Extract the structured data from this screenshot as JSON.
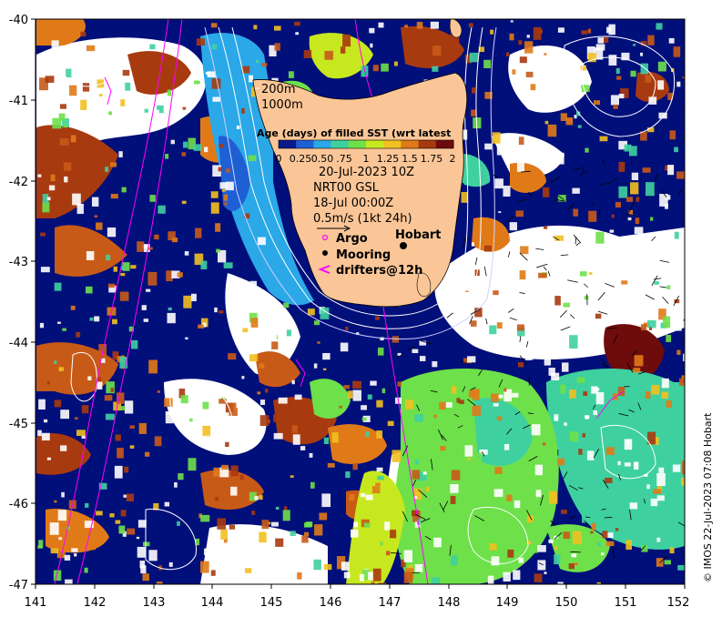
{
  "map": {
    "x_ticks": [
      "141",
      "142",
      "143",
      "144",
      "145",
      "146",
      "147",
      "148",
      "149",
      "150",
      "151",
      "152"
    ],
    "y_ticks": [
      "-40",
      "-41",
      "-42",
      "-43",
      "-44",
      "-45",
      "-46",
      "-47"
    ],
    "lon_range": [
      141,
      152
    ],
    "lat_range": [
      -47,
      -40
    ]
  },
  "depth_contours": {
    "label_200": "200m",
    "label_1000": "1000m"
  },
  "colorbar": {
    "title": "Age (days) of filled SST (wrt latest",
    "ticks": [
      "0",
      "0.25",
      "0.50",
      ".75",
      "1",
      "1.25",
      "1.5",
      "1.75",
      "2"
    ],
    "colors": [
      "#0a1a8c",
      "#1f5fd4",
      "#2aa8e8",
      "#3fd0a0",
      "#6ee04a",
      "#c7e81e",
      "#f2c020",
      "#e07a18",
      "#a83a10",
      "#6e0c0c"
    ]
  },
  "info": {
    "date": "20-Jul-2023 10Z",
    "product": "NRT00 GSL",
    "current_date": "18-Jul 00:00Z",
    "scale": "0.5m/s (1kt 24h)"
  },
  "legend": {
    "argo": "Argo",
    "mooring": "Mooring",
    "drifters": "drifters@12h"
  },
  "place": {
    "hobart": "Hobart"
  },
  "credit": "© IMOS 22-Jul-2023 07:08 Hobart",
  "colors": {
    "deep_blue": "#000f7a",
    "land": "#fbc697",
    "argo": "#ff00ff",
    "drifter": "#ff00ff"
  }
}
